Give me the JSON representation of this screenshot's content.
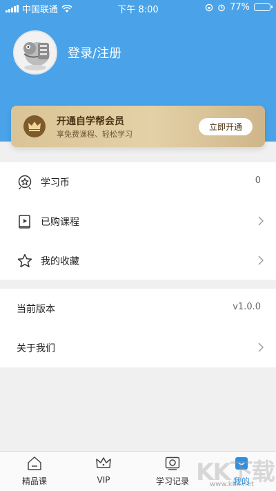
{
  "status_bar": {
    "carrier": "中国联通",
    "time": "下午 8:00",
    "battery": "77%",
    "battery_level": 0.77
  },
  "profile": {
    "login_label": "登录/注册"
  },
  "vip_card": {
    "title": "开通自学帮会员",
    "subtitle": "享免费课程、轻松学习",
    "button_label": "立即开通",
    "colors": {
      "gold": "#d9c497",
      "brown": "#7e5a2a"
    }
  },
  "menu": {
    "coins": {
      "label": "学习币",
      "value": "0"
    },
    "purchased": {
      "label": "已购课程"
    },
    "favorites": {
      "label": "我的收藏"
    },
    "version": {
      "label": "当前版本",
      "value": "v1.0.0"
    },
    "about": {
      "label": "关于我们"
    }
  },
  "tabbar": {
    "tabs": [
      {
        "label": "精品课",
        "icon": "home-icon"
      },
      {
        "label": "VIP",
        "icon": "crown-icon"
      },
      {
        "label": "学习记录",
        "icon": "record-icon"
      },
      {
        "label": "我的",
        "icon": "profile-icon",
        "active": true
      }
    ],
    "active_color": "#2f8fe0"
  },
  "watermark": {
    "brand": "KK下载",
    "url": "www.kkx.net"
  },
  "theme": {
    "header_color": "#4aa3e8"
  }
}
